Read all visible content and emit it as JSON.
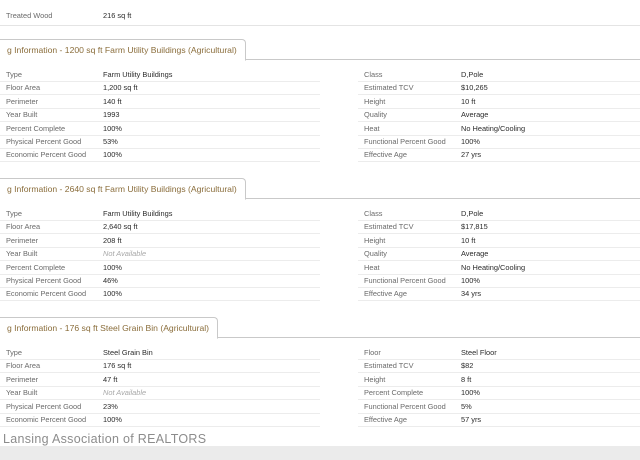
{
  "top_row": {
    "label": "Treated Wood",
    "value": "216 sq ft"
  },
  "sections": [
    {
      "title": "g Information - 1200 sq ft Farm Utility Buildings (Agricultural)",
      "left": [
        {
          "label": "Type",
          "value": "Farm Utility Buildings"
        },
        {
          "label": "Floor Area",
          "value": "1,200 sq ft"
        },
        {
          "label": "Perimeter",
          "value": "140 ft"
        },
        {
          "label": "Year Built",
          "value": "1993"
        },
        {
          "label": "Percent Complete",
          "value": "100%"
        },
        {
          "label": "Physical Percent Good",
          "value": "53%"
        },
        {
          "label": "Economic Percent Good",
          "value": "100%"
        }
      ],
      "right": [
        {
          "label": "Class",
          "value": "D,Pole"
        },
        {
          "label": "Estimated TCV",
          "value": "$10,265"
        },
        {
          "label": "Height",
          "value": "10 ft"
        },
        {
          "label": "Quality",
          "value": "Average"
        },
        {
          "label": "Heat",
          "value": "No Heating/Cooling"
        },
        {
          "label": "Functional Percent Good",
          "value": "100%"
        },
        {
          "label": "Effective Age",
          "value": "27 yrs"
        }
      ]
    },
    {
      "title": "g Information - 2640 sq ft Farm Utility Buildings (Agricultural)",
      "left": [
        {
          "label": "Type",
          "value": "Farm Utility Buildings"
        },
        {
          "label": "Floor Area",
          "value": "2,640 sq ft"
        },
        {
          "label": "Perimeter",
          "value": "208 ft"
        },
        {
          "label": "Year Built",
          "value": "Not Available"
        },
        {
          "label": "Percent Complete",
          "value": "100%"
        },
        {
          "label": "Physical Percent Good",
          "value": "46%"
        },
        {
          "label": "Economic Percent Good",
          "value": "100%"
        }
      ],
      "right": [
        {
          "label": "Class",
          "value": "D,Pole"
        },
        {
          "label": "Estimated TCV",
          "value": "$17,815"
        },
        {
          "label": "Height",
          "value": "10 ft"
        },
        {
          "label": "Quality",
          "value": "Average"
        },
        {
          "label": "Heat",
          "value": "No Heating/Cooling"
        },
        {
          "label": "Functional Percent Good",
          "value": "100%"
        },
        {
          "label": "Effective Age",
          "value": "34 yrs"
        }
      ]
    },
    {
      "title": "g Information - 176 sq ft Steel Grain Bin (Agricultural)",
      "left": [
        {
          "label": "Type",
          "value": "Steel Grain Bin"
        },
        {
          "label": "Floor Area",
          "value": "176 sq ft"
        },
        {
          "label": "Perimeter",
          "value": "47 ft"
        },
        {
          "label": "Year Built",
          "value": "Not Available"
        },
        {
          "label": "Physical Percent Good",
          "value": "23%"
        },
        {
          "label": "Economic Percent Good",
          "value": "100%"
        }
      ],
      "right": [
        {
          "label": "Floor",
          "value": "Steel Floor"
        },
        {
          "label": "Estimated TCV",
          "value": "$82"
        },
        {
          "label": "Height",
          "value": "8 ft"
        },
        {
          "label": "Percent Complete",
          "value": "100%"
        },
        {
          "label": "Functional Percent Good",
          "value": "5%"
        },
        {
          "label": "Effective Age",
          "value": "57 yrs"
        }
      ]
    }
  ],
  "footer": {
    "watermark_text": "Lansing Association of REALTORS"
  },
  "colors": {
    "header_text": "#8a6d3b",
    "label_text": "#6a6a6a",
    "value_text": "#2b2b2b",
    "na_text": "#a8a8a8"
  }
}
